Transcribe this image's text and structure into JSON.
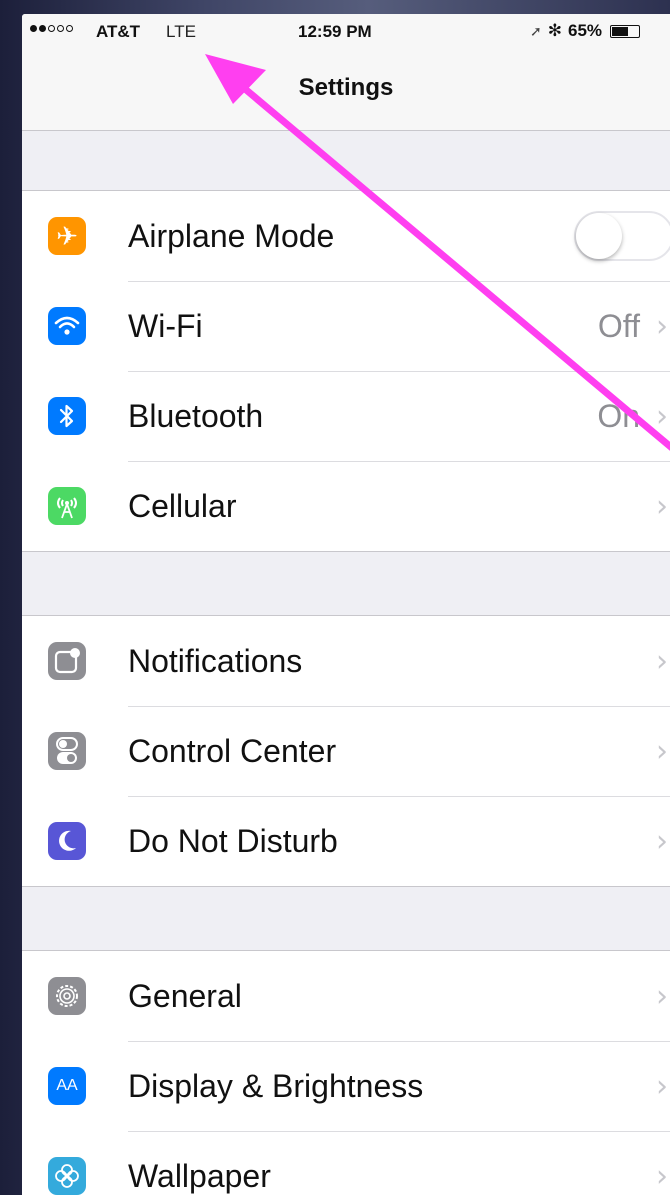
{
  "status_bar": {
    "signal_strength": 2,
    "signal_max": 5,
    "carrier": "AT&T",
    "network": "LTE",
    "time": "12:59 PM",
    "battery_percent": "65%",
    "battery_level": 0.65,
    "location_icon": "location-arrow-icon",
    "bluetooth_icon": "bluetooth-icon"
  },
  "nav": {
    "title": "Settings"
  },
  "groups": [
    {
      "items": [
        {
          "label": "Airplane Mode",
          "icon": "airplane-icon",
          "icon_color": "#ff9500",
          "control": "toggle",
          "toggle_on": false
        },
        {
          "label": "Wi-Fi",
          "icon": "wifi-icon",
          "icon_color": "#007aff",
          "value": "Off"
        },
        {
          "label": "Bluetooth",
          "icon": "bluetooth-icon",
          "icon_color": "#007aff",
          "value": "On"
        },
        {
          "label": "Cellular",
          "icon": "cellular-antenna-icon",
          "icon_color": "#4cd964",
          "value": ""
        }
      ]
    },
    {
      "items": [
        {
          "label": "Notifications",
          "icon": "notifications-icon",
          "icon_color": "#8e8e93"
        },
        {
          "label": "Control Center",
          "icon": "control-center-icon",
          "icon_color": "#8e8e93"
        },
        {
          "label": "Do Not Disturb",
          "icon": "moon-icon",
          "icon_color": "#5856d6"
        }
      ]
    },
    {
      "items": [
        {
          "label": "General",
          "icon": "gear-icon",
          "icon_color": "#8e8e93"
        },
        {
          "label": "Display & Brightness",
          "icon": "display-brightness-icon",
          "icon_color": "#007aff",
          "icon_text": "AA"
        },
        {
          "label": "Wallpaper",
          "icon": "wallpaper-icon",
          "icon_color": "#34aadc"
        }
      ]
    }
  ],
  "chevron": "›",
  "annotation": {
    "color": "#ff3ff0",
    "points_to": "network"
  }
}
